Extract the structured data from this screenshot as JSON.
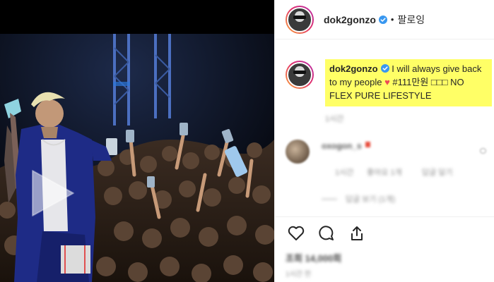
{
  "post": {
    "username": "dok2gonzo",
    "separator": "•",
    "follow_state": "팔로잉"
  },
  "caption": {
    "username": "dok2gonzo",
    "text_before_heart": "I will always give back to my people",
    "heart": "♥",
    "text_after_heart": "#111만원 □□□ NO FLEX PURE LIFESTYLE"
  },
  "blurred": {
    "caption_time": "1시간",
    "comment_user": "oxogon_s",
    "comment_time": "1시간",
    "comment_likes": "좋아요 1개",
    "comment_reply": "답글 달기",
    "view_replies": "답글 보기 (1개)",
    "likes_count": "조회 14,000회",
    "post_date": "1시간 전"
  },
  "colors": {
    "highlight": "#ffff66",
    "verified": "#3897f0",
    "heart": "#ed4956"
  },
  "icons": [
    "play-icon",
    "verified-icon",
    "heart-icon",
    "comment-icon",
    "share-icon"
  ]
}
